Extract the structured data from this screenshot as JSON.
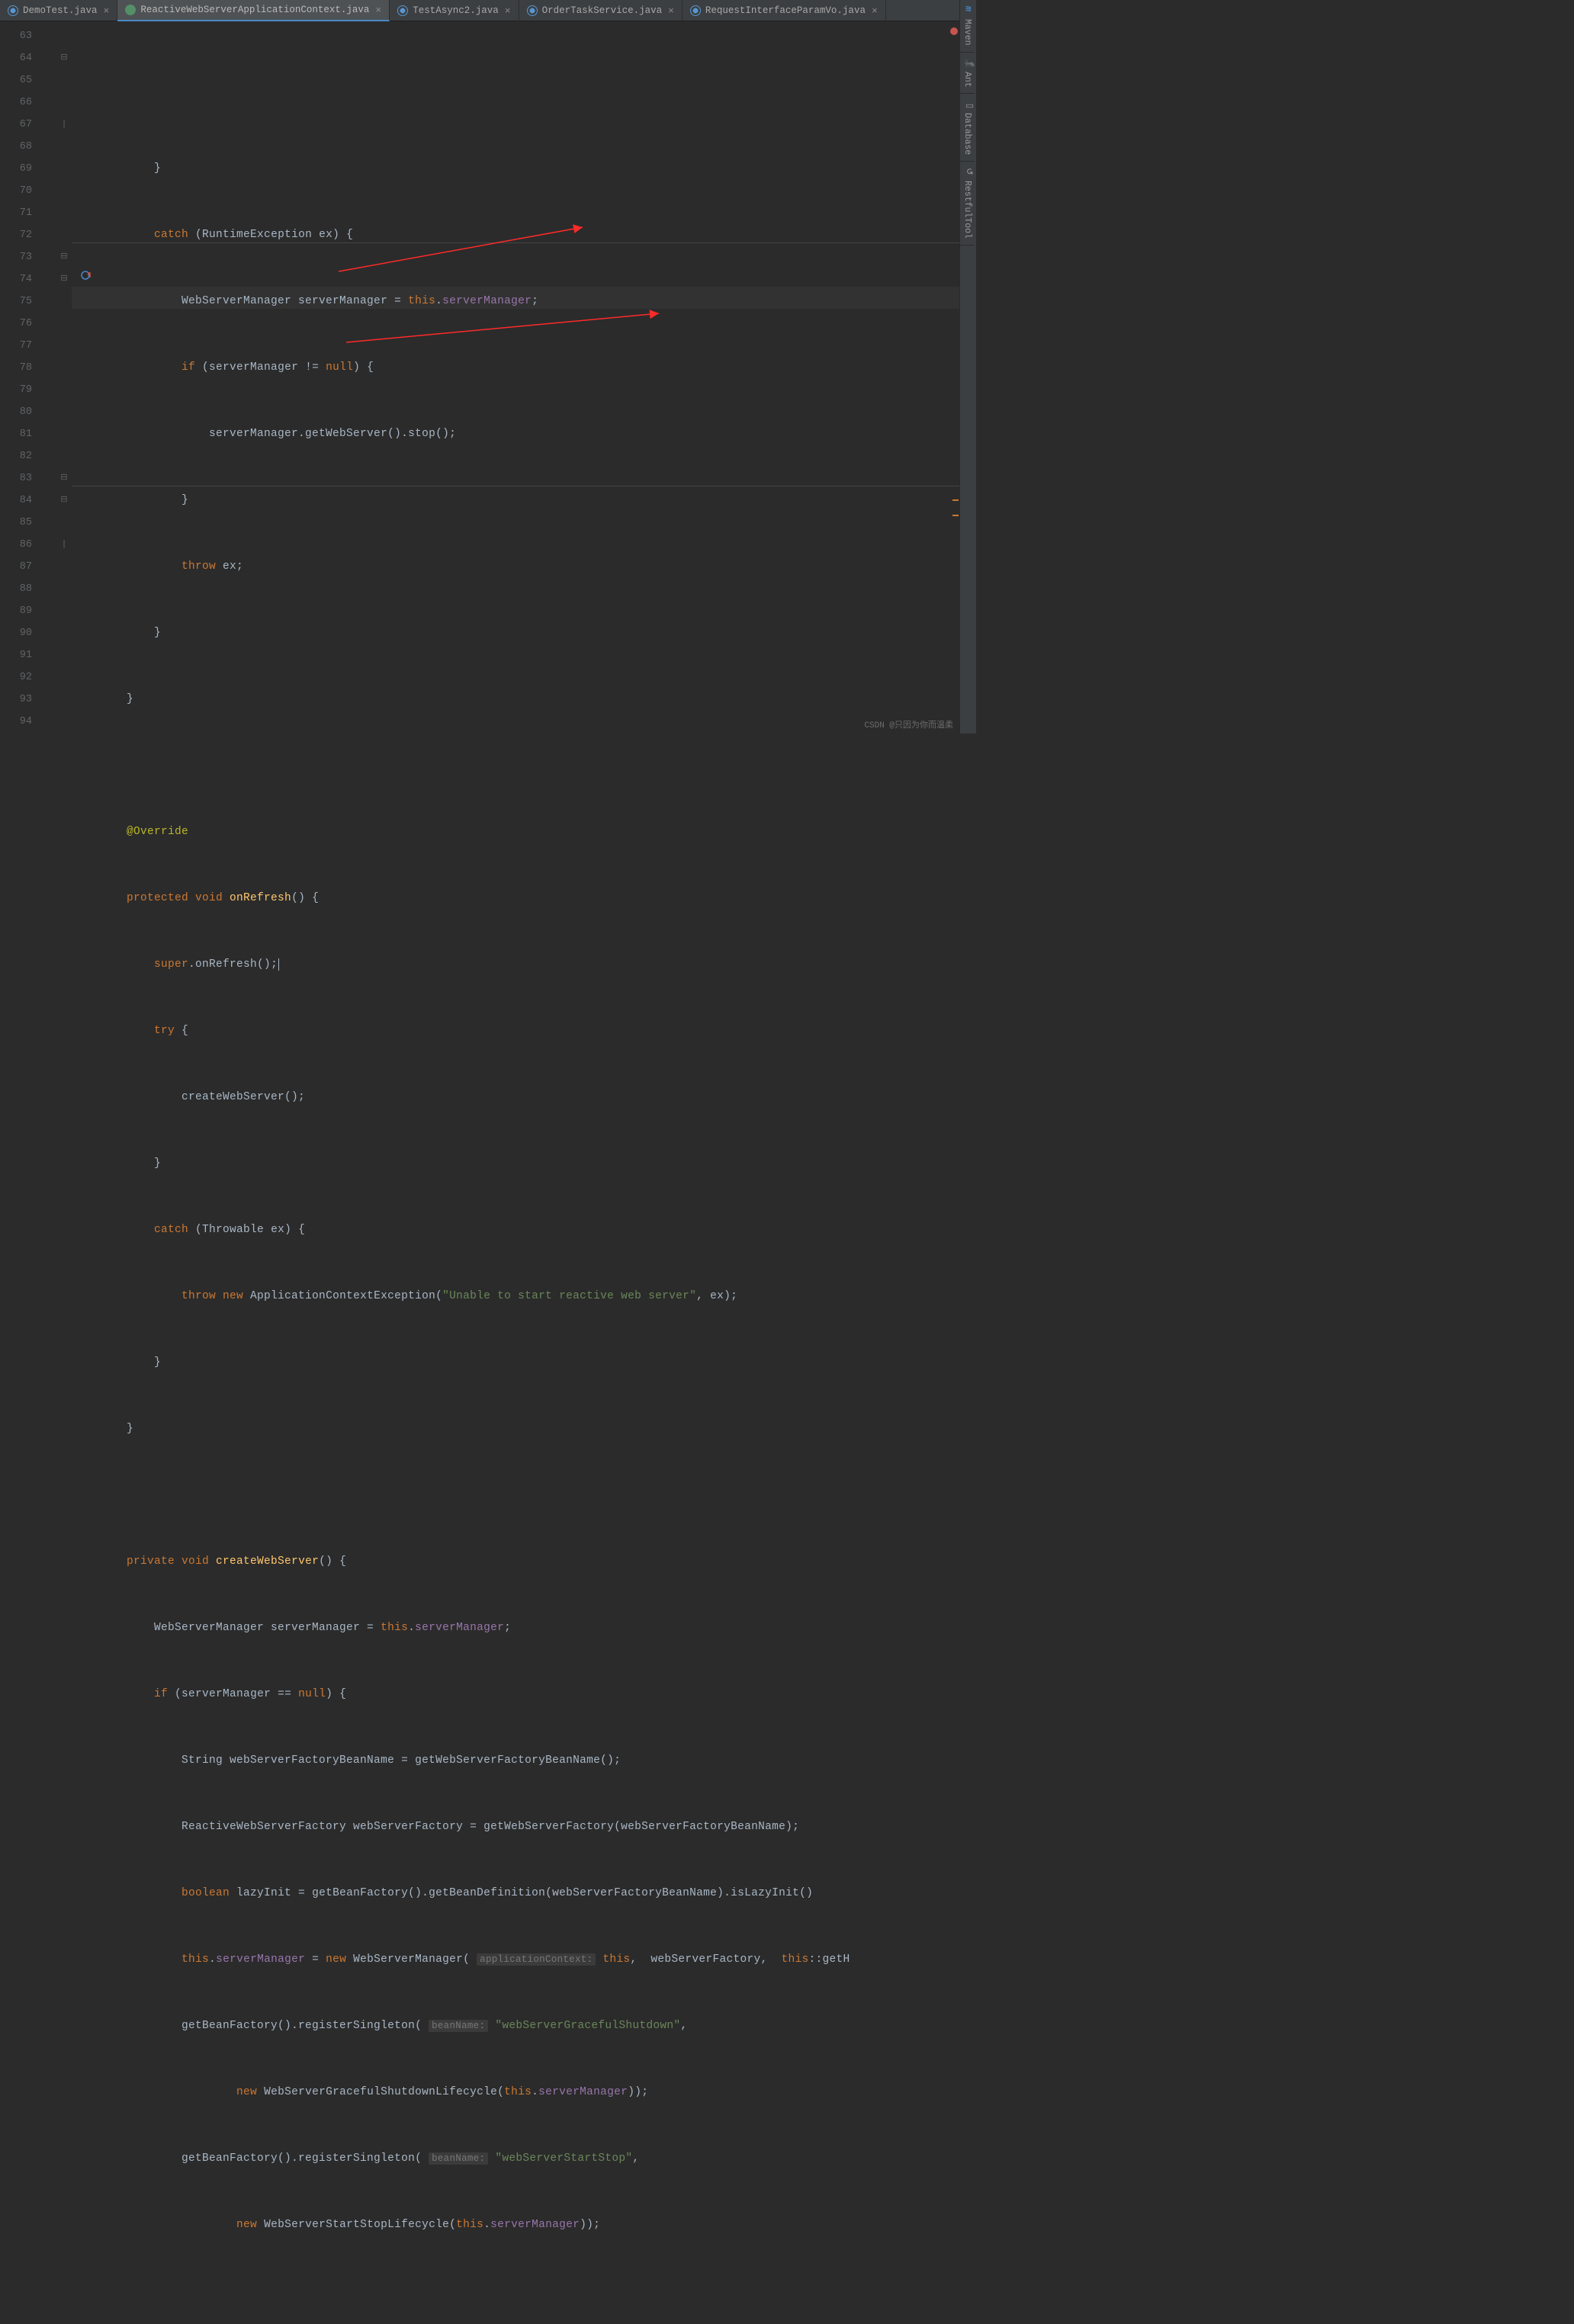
{
  "tabs": [
    {
      "icon": "ic-java",
      "label": "DemoTest.java",
      "active": false
    },
    {
      "icon": "ic-cls",
      "label": "ReactiveWebServerApplicationContext.java",
      "active": true
    },
    {
      "icon": "ic-java",
      "label": "TestAsync2.java",
      "active": false
    },
    {
      "icon": "ic-java",
      "label": "OrderTaskService.java",
      "active": false
    },
    {
      "icon": "ic-java",
      "label": "RequestInterfaceParamVo.java",
      "active": false
    }
  ],
  "close_glyph": "×",
  "right_tools": [
    {
      "glyph": "m",
      "color": "#4a88c7",
      "label": "Maven"
    },
    {
      "glyph": "🐜",
      "label": "Ant"
    },
    {
      "glyph": "▭",
      "label": "Database"
    },
    {
      "glyph": "↺",
      "label": "RestfulTool"
    }
  ],
  "line_start": 63,
  "gutter_lines": [
    "63",
    "64",
    "65",
    "66",
    "67",
    "68",
    "69",
    "70",
    "71",
    "72",
    "73",
    "74",
    "75",
    "76",
    "77",
    "78",
    "79",
    "80",
    "81",
    "82",
    "83",
    "84",
    "85",
    "86",
    "87",
    "88",
    "89",
    "90",
    "91",
    "92",
    "93",
    "94"
  ],
  "folds": {
    "1": "⊟",
    "4": "|",
    "10": "⊟",
    "11": "⊟",
    "20": "⊟",
    "21": "⊟",
    "23": "|"
  },
  "current_line_index": 12,
  "code": {
    "l0": "            }",
    "l1a": "            ",
    "l1b": "catch",
    "l1c": " (RuntimeException ex) {",
    "l2a": "                WebServerManager serverManager = ",
    "l2b": "this",
    "l2c": ".",
    "l2d": "serverManager",
    "l2e": ";",
    "l3a": "                ",
    "l3b": "if",
    "l3c": " (serverManager != ",
    "l3d": "null",
    "l3e": ") {",
    "l4": "                    serverManager.getWebServer().stop();",
    "l5": "                }",
    "l6a": "                ",
    "l6b": "throw",
    "l6c": " ex;",
    "l7": "            }",
    "l8": "        }",
    "l9": "",
    "l10a": "        ",
    "l10b": "@Override",
    "l11a": "        ",
    "l11b": "protected void ",
    "l11c": "onRefresh",
    "l11d": "() {",
    "l12a": "            ",
    "l12b": "super",
    "l12c": ".onRefresh();",
    "l13a": "            ",
    "l13b": "try",
    "l13c": " {",
    "l14": "                createWebServer();",
    "l15": "            }",
    "l16a": "            ",
    "l16b": "catch",
    "l16c": " (Throwable ex) {",
    "l17a": "                ",
    "l17b": "throw new",
    "l17c": " ApplicationContextException(",
    "l17d": "\"Unable to start reactive web server\"",
    "l17e": ", ex);",
    "l18": "            }",
    "l19": "        }",
    "l20": "",
    "l21a": "        ",
    "l21b": "private void ",
    "l21c": "createWebServer",
    "l21d": "() {",
    "l22a": "            WebServerManager serverManager = ",
    "l22b": "this",
    "l22c": ".",
    "l22d": "serverManager",
    "l22e": ";",
    "l23a": "            ",
    "l23b": "if",
    "l23c": " (serverManager == ",
    "l23d": "null",
    "l23e": ") {",
    "l24": "                String webServerFactoryBeanName = getWebServerFactoryBeanName();",
    "l25": "                ReactiveWebServerFactory webServerFactory = getWebServerFactory(webServerFactoryBeanName);",
    "l26a": "                ",
    "l26b": "boolean",
    "l26c": " lazyInit = getBeanFactory().getBeanDefinition(webServerFactoryBeanName).isLazyInit()",
    "l27a": "                ",
    "l27b": "this",
    "l27c": ".",
    "l27d": "serverManager",
    "l27e": " = ",
    "l27f": "new",
    "l27g": " WebServerManager( ",
    "l27h": "applicationContext:",
    "l27i": " ",
    "l27j": "this",
    "l27k": ",  webServerFactory,  ",
    "l27l": "this",
    "l27m": "::getH",
    "l28a": "                getBeanFactory().registerSingleton( ",
    "l28b": "beanName:",
    "l28c": " ",
    "l28d": "\"webServerGracefulShutdown\"",
    "l28e": ",",
    "l29a": "                        ",
    "l29b": "new",
    "l29c": " WebServerGracefulShutdownLifecycle(",
    "l29d": "this",
    "l29e": ".",
    "l29f": "serverManager",
    "l29g": "));",
    "l30a": "                getBeanFactory().registerSingleton( ",
    "l30b": "beanName:",
    "l30c": " ",
    "l30d": "\"webServerStartStop\"",
    "l30e": ",",
    "l31a": "                        ",
    "l31b": "new",
    "l31c": " WebServerStartStopLifecycle(",
    "l31d": "this",
    "l31e": ".",
    "l31f": "serverManager",
    "l31g": "));"
  },
  "watermark": "CSDN @只因为你而温柔"
}
